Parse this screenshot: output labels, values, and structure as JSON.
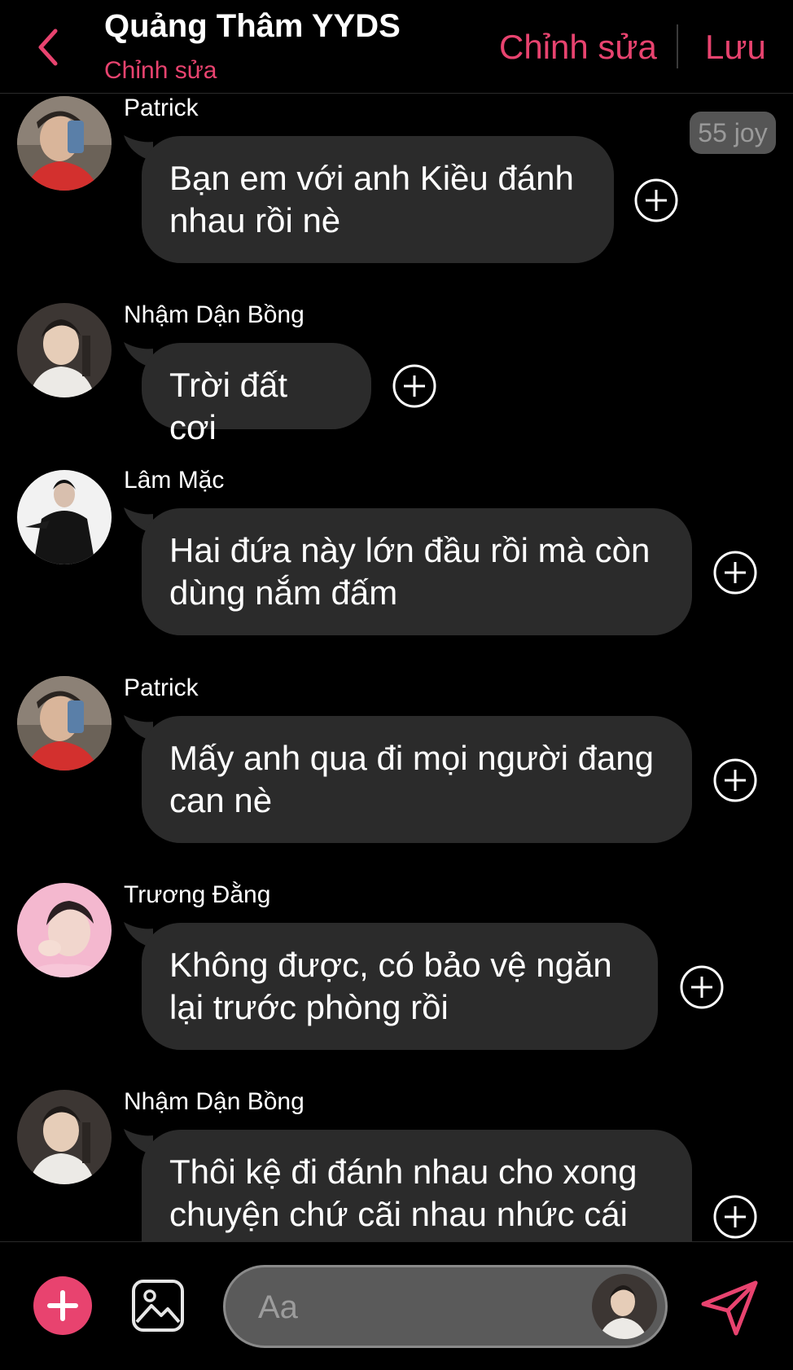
{
  "header": {
    "title": "Quảng Thâm YYDS",
    "subtitle": "Chỉnh sửa",
    "edit_label": "Chỉnh sửa",
    "save_label": "Lưu"
  },
  "badge": "55 joy",
  "messages": [
    {
      "sender": "Patrick",
      "lines": [
        "Bạn em với anh Kiều đánh",
        "nhau rồi nè"
      ]
    },
    {
      "sender": "Nhậm Dận Bồng",
      "lines": [
        "Trời đất cơi"
      ]
    },
    {
      "sender": "Lâm Mặc",
      "lines": [
        "Hai đứa này lớn đầu rồi mà còn",
        "dùng nắm đấm"
      ]
    },
    {
      "sender": "Patrick",
      "lines": [
        "Mấy anh qua đi mọi người đang",
        "can nè"
      ]
    },
    {
      "sender": "Trương Đằng",
      "lines": [
        "Không được, có bảo vệ ngăn",
        "lại trước phòng rồi"
      ]
    },
    {
      "sender": "Nhậm Dận Bồng",
      "lines": [
        "Thôi kệ đi đánh nhau cho xong",
        "chuyện chứ cãi nhau nhức cái"
      ]
    }
  ],
  "composer": {
    "placeholder": "Aa"
  },
  "colors": {
    "accent": "#e8436f",
    "bubble": "#2b2b2b",
    "background": "#000000"
  },
  "icons": {
    "back": "chevron-left-icon",
    "add": "plus-circle-icon",
    "plus": "plus-icon",
    "image": "image-icon",
    "send": "send-icon"
  }
}
